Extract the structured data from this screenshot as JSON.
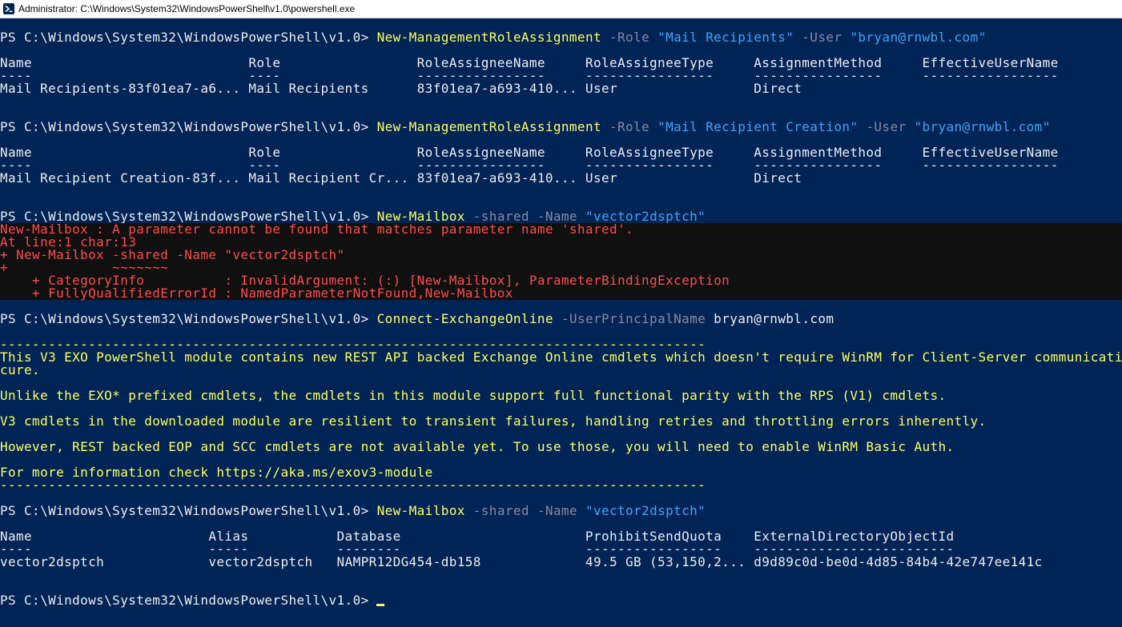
{
  "window": {
    "title": "Administrator: C:\\Windows\\System32\\WindowsPowerShell\\v1.0\\powershell.exe",
    "icon": "powershell-icon"
  },
  "colors": {
    "background": "#012456",
    "command": "#ffff60",
    "parameter": "#8a8aa0",
    "string": "#42a5f5",
    "error": "#ff4d4d",
    "error_background": "#101010",
    "text": "#eeedf0"
  },
  "prompt": "PS C:\\Windows\\System32\\WindowsPowerShell\\v1.0> ",
  "block1": {
    "cmd": "New-ManagementRoleAssignment",
    "p1": " -Role ",
    "s1": "\"Mail Recipients\"",
    "p2": " -User ",
    "s2": "\"bryan@rnwbl.com\"",
    "header": "Name                           Role                 RoleAssigneeName     RoleAssigneeType     AssignmentMethod     EffectiveUserName",
    "separator": "----                           ----                 ----------------     ----------------     ----------------     -----------------",
    "row": "Mail Recipients-83f01ea7-a6... Mail Recipients      83f01ea7-a693-410... User                 Direct"
  },
  "block2": {
    "cmd": "New-ManagementRoleAssignment",
    "p1": " -Role ",
    "s1": "\"Mail Recipient Creation\"",
    "p2": " -User ",
    "s2": "\"bryan@rnwbl.com\"",
    "header": "Name                           Role                 RoleAssigneeName     RoleAssigneeType     AssignmentMethod     EffectiveUserName",
    "separator": "----                           ----                 ----------------     ----------------     ----------------     -----------------",
    "row": "Mail Recipient Creation-83f... Mail Recipient Cr... 83f01ea7-a693-410... User                 Direct"
  },
  "block3": {
    "cmd": "New-Mailbox",
    "p1": " -shared -Name ",
    "s1": "\"vector2dsptch\"",
    "error": [
      "New-Mailbox : A parameter cannot be found that matches parameter name 'shared'.",
      "At line:1 char:13",
      "+ New-Mailbox -shared -Name \"vector2dsptch\"",
      "+             ~~~~~~~",
      "    + CategoryInfo          : InvalidArgument: (:) [New-Mailbox], ParameterBindingException",
      "    + FullyQualifiedErrorId : NamedParameterNotFound,New-Mailbox"
    ]
  },
  "block4": {
    "cmd": "Connect-ExchangeOnline",
    "p1": " -UserPrincipalName ",
    "a1": "bryan@rnwbl.com",
    "banner_rule": "----------------------------------------------------------------------------------------",
    "banner": [
      "This V3 EXO PowerShell module contains new REST API backed Exchange Online cmdlets which doesn't require WinRM for Client-Server communicati",
      "cure.",
      "Unlike the EXO* prefixed cmdlets, the cmdlets in this module support full functional parity with the RPS (V1) cmdlets.",
      "V3 cmdlets in the downloaded module are resilient to transient failures, handling retries and throttling errors inherently.",
      "However, REST backed EOP and SCC cmdlets are not available yet. To use those, you will need to enable WinRM Basic Auth.",
      "For more information check https://aka.ms/exov3-module"
    ]
  },
  "block5": {
    "cmd": "New-Mailbox",
    "p1": " -shared -Name ",
    "s1": "\"vector2dsptch\"",
    "header": "Name                      Alias           Database                       ProhibitSendQuota    ExternalDirectoryObjectId",
    "separator": "----                      -----           --------                       -----------------    -------------------------",
    "row": "vector2dsptch             vector2dsptch   NAMPR12DG454-db158             49.5 GB (53,150,2... d9d89c0d-be0d-4d85-84b4-42e747ee141c"
  }
}
